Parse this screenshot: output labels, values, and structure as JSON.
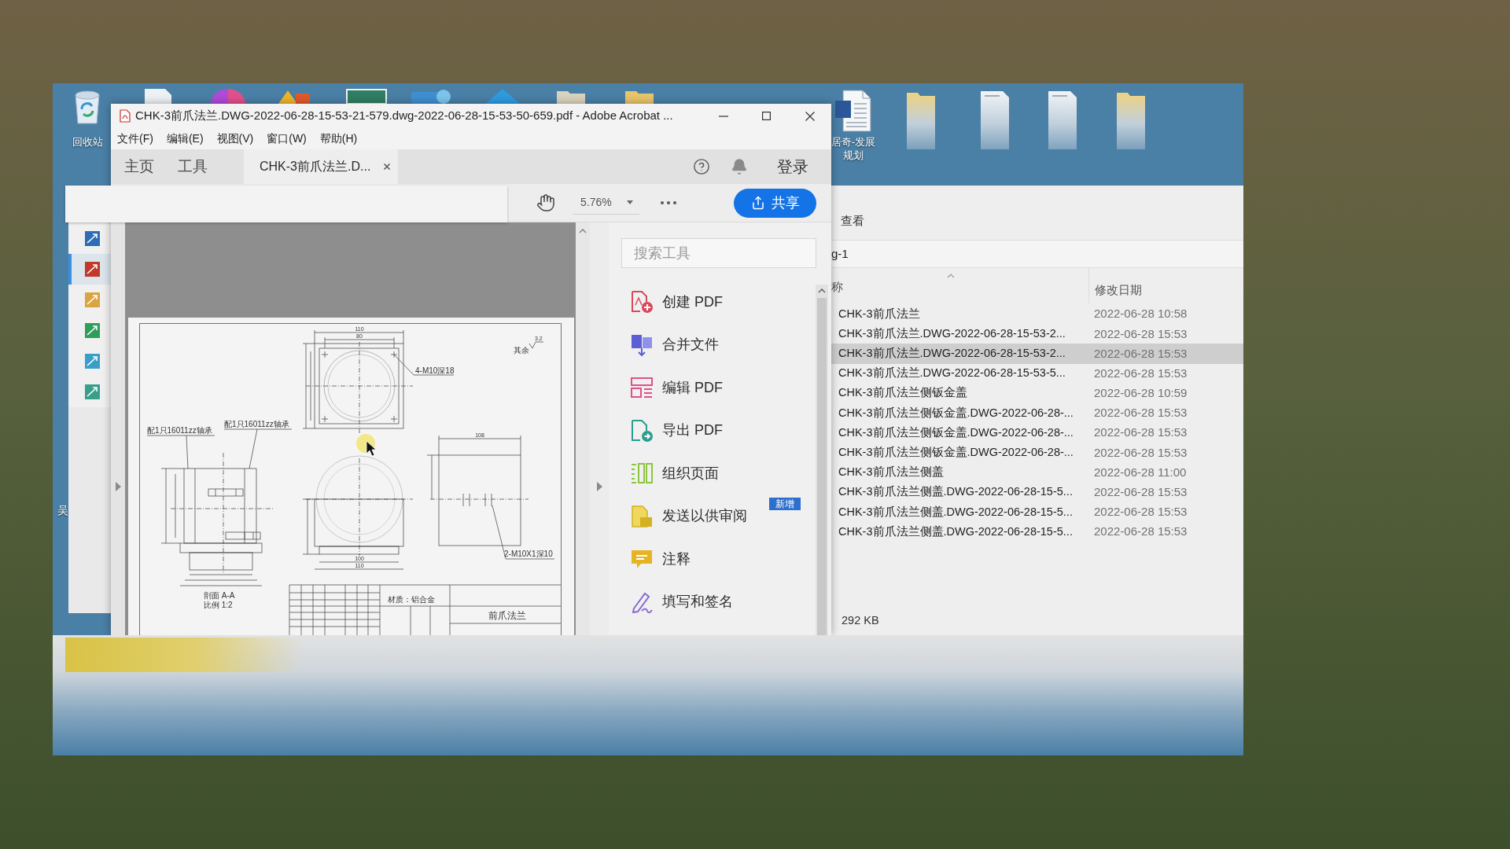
{
  "desktop": {
    "icons": [
      {
        "kind": "recycle-bin",
        "label": "回收站"
      },
      {
        "kind": "word-document",
        "label": "居奇-发展规划"
      },
      {
        "kind": "folder"
      },
      {
        "kind": "document"
      },
      {
        "kind": "document"
      },
      {
        "kind": "folder"
      }
    ],
    "edge_label": "吴"
  },
  "acrobat": {
    "title": "CHK-3前爪法兰.DWG-2022-06-28-15-53-21-579.dwg-2022-06-28-15-53-50-659.pdf - Adobe Acrobat ...",
    "menu": [
      "文件(F)",
      "编辑(E)",
      "视图(V)",
      "窗口(W)",
      "帮助(H)"
    ],
    "tabs": [
      {
        "kind": "page",
        "label": "主页",
        "selected": false
      },
      {
        "kind": "page",
        "label": "工具",
        "selected": false
      },
      {
        "kind": "document",
        "label": "CHK-3前爪法兰.D...",
        "selected": true
      }
    ],
    "sign_in": "登录",
    "zoom": "5.76%",
    "share": "共享",
    "drawing": {
      "roughness_value": "3.2",
      "roughness_note": "其余",
      "top_view_dims": [
        "110",
        "80"
      ],
      "hole_note": "4-M10深18",
      "bearing_notes": [
        "配1只16011zz轴承",
        "配1只16011zz轴承"
      ],
      "front_view_dims": [
        "100",
        "110"
      ],
      "side_view_dim": "108",
      "thread_note": "2-M10X1深10",
      "section_caption": [
        "剖面 A-A",
        "比例 1:2"
      ],
      "material": "材质：铝合金",
      "part_name": "前爪法兰"
    },
    "tools_search": {
      "placeholder": "搜索工具"
    },
    "tools": [
      {
        "kind": "create",
        "label": "创建 PDF"
      },
      {
        "kind": "combine",
        "label": "合并文件"
      },
      {
        "kind": "edit",
        "label": "编辑 PDF"
      },
      {
        "kind": "export",
        "label": "导出 PDF"
      },
      {
        "kind": "organize",
        "label": "组织页面"
      },
      {
        "kind": "send",
        "label": "发送以供审阅",
        "badge": "新增"
      },
      {
        "kind": "comment",
        "label": "注释"
      },
      {
        "kind": "sign",
        "label": "填写和签名"
      }
    ]
  },
  "explorer": {
    "nav_items": [
      {
        "color": "#2d6db5",
        "selected": false
      },
      {
        "color": "#c0392b",
        "selected": true
      },
      {
        "color": "#d9a441",
        "selected": false
      },
      {
        "color": "#2e9e5b",
        "selected": false
      },
      {
        "color": "#3a9fc8",
        "selected": false
      },
      {
        "color": "#3a9f8a",
        "selected": false
      }
    ],
    "ribbon_tab": "查看",
    "address": "g-1",
    "columns": [
      "称",
      "修改日期"
    ],
    "rows": [
      {
        "name": "CHK-3前爪法兰",
        "date": "2022-06-28 10:58",
        "selected": false
      },
      {
        "name": "CHK-3前爪法兰.DWG-2022-06-28-15-53-2...",
        "date": "2022-06-28 15:53",
        "selected": false
      },
      {
        "name": "CHK-3前爪法兰.DWG-2022-06-28-15-53-2...",
        "date": "2022-06-28 15:53",
        "selected": true
      },
      {
        "name": "CHK-3前爪法兰.DWG-2022-06-28-15-53-5...",
        "date": "2022-06-28 15:53",
        "selected": false
      },
      {
        "name": "CHK-3前爪法兰侧钣金盖",
        "date": "2022-06-28 10:59",
        "selected": false
      },
      {
        "name": "CHK-3前爪法兰侧钣金盖.DWG-2022-06-28-...",
        "date": "2022-06-28 15:53",
        "selected": false
      },
      {
        "name": "CHK-3前爪法兰侧钣金盖.DWG-2022-06-28-...",
        "date": "2022-06-28 15:53",
        "selected": false
      },
      {
        "name": "CHK-3前爪法兰侧钣金盖.DWG-2022-06-28-...",
        "date": "2022-06-28 15:53",
        "selected": false
      },
      {
        "name": "CHK-3前爪法兰侧盖",
        "date": "2022-06-28 11:00",
        "selected": false
      },
      {
        "name": "CHK-3前爪法兰侧盖.DWG-2022-06-28-15-5...",
        "date": "2022-06-28 15:53",
        "selected": false
      },
      {
        "name": "CHK-3前爪法兰侧盖.DWG-2022-06-28-15-5...",
        "date": "2022-06-28 15:53",
        "selected": false
      },
      {
        "name": "CHK-3前爪法兰侧盖.DWG-2022-06-28-15-5...",
        "date": "2022-06-28 15:53",
        "selected": false
      }
    ],
    "status": "292 KB"
  }
}
